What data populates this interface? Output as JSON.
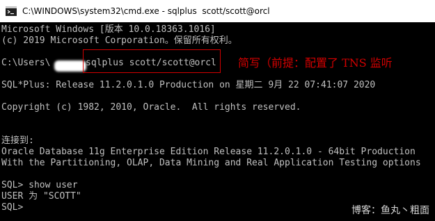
{
  "window": {
    "title": "C:\\WINDOWS\\system32\\cmd.exe - sqlplus  scott/scott@orcl",
    "icon": "cmd-icon"
  },
  "console": {
    "lines": [
      "Microsoft Windows [版本 10.0.18363.1016]",
      "(c) 2019 Microsoft Corporation。保留所有权利。",
      "",
      "C:\\Users\\",
      "",
      "SQL*Plus: Release 11.2.0.1.0 Production on 星期二 9月 22 07:41:07 2020",
      "",
      "Copyright (c) 1982, 2010, Oracle.  All rights reserved.",
      "",
      "",
      "连接到:",
      "Oracle Database 11g Enterprise Edition Release 11.2.0.1.0 - 64bit Production",
      "With the Partitioning, OLAP, Data Mining and Real Application Testing options",
      "",
      "SQL> show user",
      "USER 为 \"SCOTT\"",
      "SQL>"
    ],
    "command": "sqlplus scott/scott@orcl",
    "annotation": "简写（前提：配置了 TNS 监听",
    "watermark": "博客：鱼丸丶粗面"
  },
  "colors": {
    "console_text": "#c0c0c0",
    "console_bg": "#000000",
    "annotation": "#d40000",
    "titlebar_bg": "#ffffff"
  }
}
